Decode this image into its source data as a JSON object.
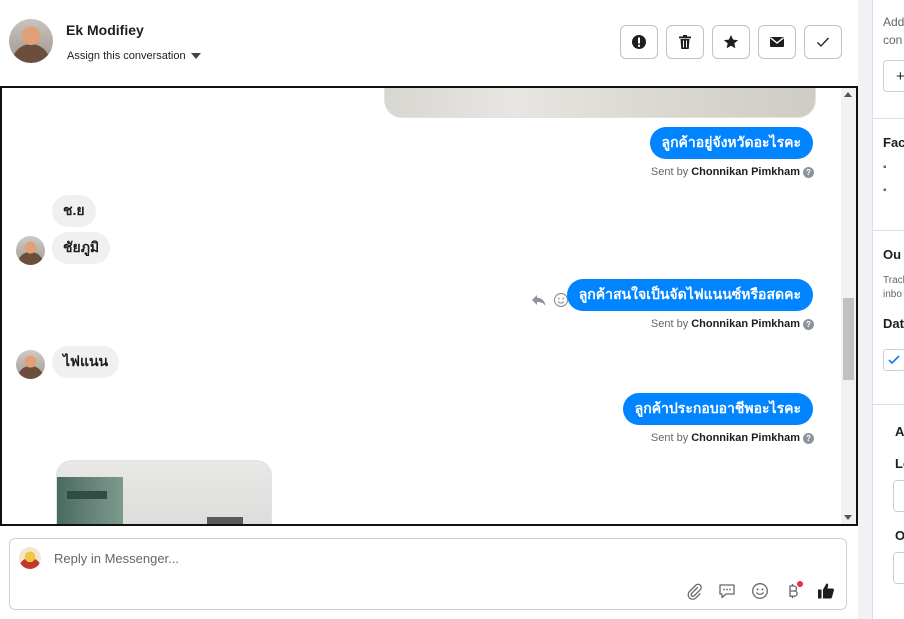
{
  "header": {
    "contact_name": "Ek Modifiey",
    "assign_label": "Assign this conversation",
    "actions": [
      {
        "name": "spam",
        "icon": "exclamation-icon"
      },
      {
        "name": "delete",
        "icon": "trash-icon"
      },
      {
        "name": "star",
        "icon": "star-icon"
      },
      {
        "name": "mark-unread",
        "icon": "envelope-icon"
      },
      {
        "name": "done",
        "icon": "check-icon"
      }
    ]
  },
  "messages": [
    {
      "direction": "out",
      "text": "ลูกค้าอยู่จังหวัดอะไรคะ",
      "sent_prefix": "Sent by",
      "sender": "Chonnikan Pimkham"
    },
    {
      "direction": "in",
      "text": "ช.ย"
    },
    {
      "direction": "in",
      "text": "ชัยภูมิ"
    },
    {
      "direction": "out",
      "text": "ลูกค้าสนใจเป็นจัดไฟแนนซ์หรือสดคะ",
      "sent_prefix": "Sent by",
      "sender": "Chonnikan Pimkham"
    },
    {
      "direction": "in",
      "text": "ไฟแนน"
    },
    {
      "direction": "out",
      "text": "ลูกค้าประกอบอาชีพอะไรคะ",
      "sent_prefix": "Sent by",
      "sender": "Chonnikan Pimkham"
    }
  ],
  "composer": {
    "placeholder": "Reply in Messenger...",
    "tools": [
      "paperclip-icon",
      "saved-reply-icon",
      "emoji-icon",
      "baht-icon",
      "thumbs-up-icon"
    ]
  },
  "right_panel": {
    "line1": "Add",
    "line2": "con",
    "add_button": "+",
    "section_facebook": "Fac",
    "section_ou": "Ou",
    "track_line1": "Track",
    "track_line2": "inbo",
    "section_dat": "Dat",
    "section_a": "A",
    "section_l": "Le",
    "section_o": "O"
  },
  "colors": {
    "outgoing_bubble": "#0084ff",
    "incoming_bubble": "#f0f0f0",
    "notification_dot": "#f02849"
  }
}
